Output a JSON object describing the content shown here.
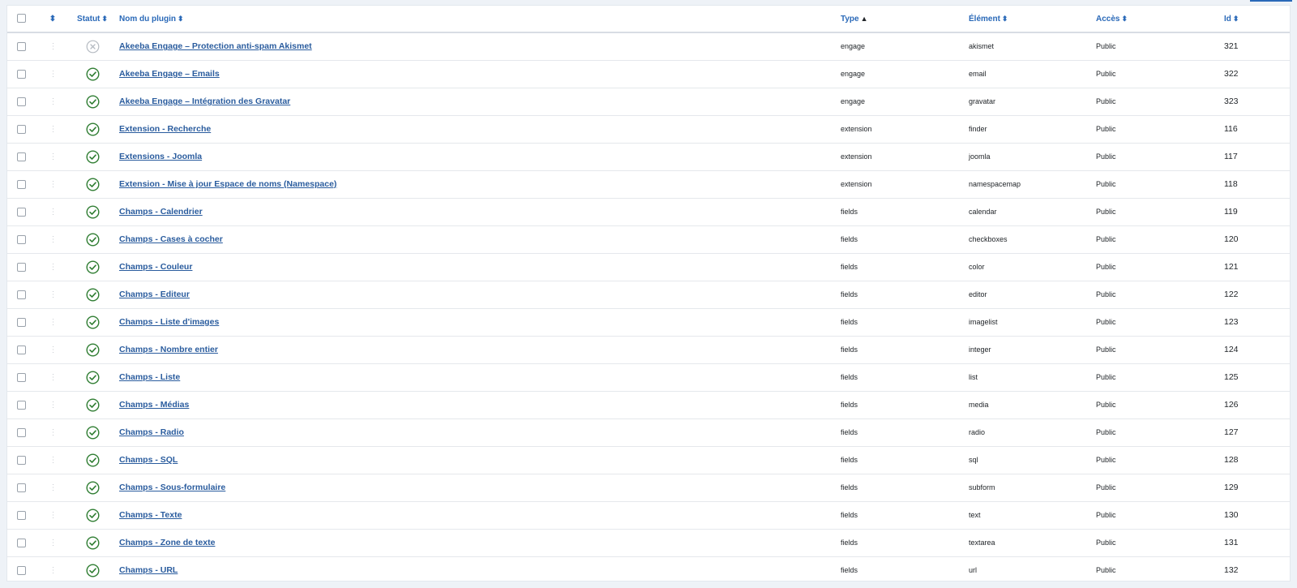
{
  "header": {
    "status": "Statut",
    "name": "Nom du plugin",
    "type": "Type",
    "element": "Élément",
    "access": "Accès",
    "id": "Id"
  },
  "icons": {
    "sort": "sort-arrows-icon",
    "sort_asc": "sort-asc-icon",
    "enabled": "check-circle-icon",
    "disabled": "x-circle-icon",
    "drag": "drag-handle-icon"
  },
  "colors": {
    "accent": "#2a69b8",
    "enabled": "#2f7d32",
    "disabled": "#b5bbc2"
  },
  "rows": [
    {
      "enabled": false,
      "name": "Akeeba Engage – Protection anti-spam Akismet",
      "type": "engage",
      "element": "akismet",
      "access": "Public",
      "id": "321"
    },
    {
      "enabled": true,
      "name": "Akeeba Engage – Emails",
      "type": "engage",
      "element": "email",
      "access": "Public",
      "id": "322"
    },
    {
      "enabled": true,
      "name": "Akeeba Engage – Intégration des Gravatar",
      "type": "engage",
      "element": "gravatar",
      "access": "Public",
      "id": "323"
    },
    {
      "enabled": true,
      "name": "Extension - Recherche",
      "type": "extension",
      "element": "finder",
      "access": "Public",
      "id": "116"
    },
    {
      "enabled": true,
      "name": "Extensions - Joomla",
      "type": "extension",
      "element": "joomla",
      "access": "Public",
      "id": "117"
    },
    {
      "enabled": true,
      "name": "Extension - Mise à jour Espace de noms (Namespace)",
      "type": "extension",
      "element": "namespacemap",
      "access": "Public",
      "id": "118"
    },
    {
      "enabled": true,
      "name": "Champs - Calendrier",
      "type": "fields",
      "element": "calendar",
      "access": "Public",
      "id": "119"
    },
    {
      "enabled": true,
      "name": "Champs - Cases à cocher",
      "type": "fields",
      "element": "checkboxes",
      "access": "Public",
      "id": "120"
    },
    {
      "enabled": true,
      "name": "Champs - Couleur",
      "type": "fields",
      "element": "color",
      "access": "Public",
      "id": "121"
    },
    {
      "enabled": true,
      "name": "Champs - Editeur",
      "type": "fields",
      "element": "editor",
      "access": "Public",
      "id": "122"
    },
    {
      "enabled": true,
      "name": "Champs - Liste d'images",
      "type": "fields",
      "element": "imagelist",
      "access": "Public",
      "id": "123"
    },
    {
      "enabled": true,
      "name": "Champs - Nombre entier",
      "type": "fields",
      "element": "integer",
      "access": "Public",
      "id": "124"
    },
    {
      "enabled": true,
      "name": "Champs - Liste",
      "type": "fields",
      "element": "list",
      "access": "Public",
      "id": "125"
    },
    {
      "enabled": true,
      "name": "Champs - Médias",
      "type": "fields",
      "element": "media",
      "access": "Public",
      "id": "126"
    },
    {
      "enabled": true,
      "name": "Champs - Radio",
      "type": "fields",
      "element": "radio",
      "access": "Public",
      "id": "127"
    },
    {
      "enabled": true,
      "name": "Champs - SQL",
      "type": "fields",
      "element": "sql",
      "access": "Public",
      "id": "128"
    },
    {
      "enabled": true,
      "name": "Champs - Sous-formulaire",
      "type": "fields",
      "element": "subform",
      "access": "Public",
      "id": "129"
    },
    {
      "enabled": true,
      "name": "Champs - Texte",
      "type": "fields",
      "element": "text",
      "access": "Public",
      "id": "130"
    },
    {
      "enabled": true,
      "name": "Champs - Zone de texte",
      "type": "fields",
      "element": "textarea",
      "access": "Public",
      "id": "131"
    },
    {
      "enabled": true,
      "name": "Champs - URL",
      "type": "fields",
      "element": "url",
      "access": "Public",
      "id": "132"
    }
  ]
}
